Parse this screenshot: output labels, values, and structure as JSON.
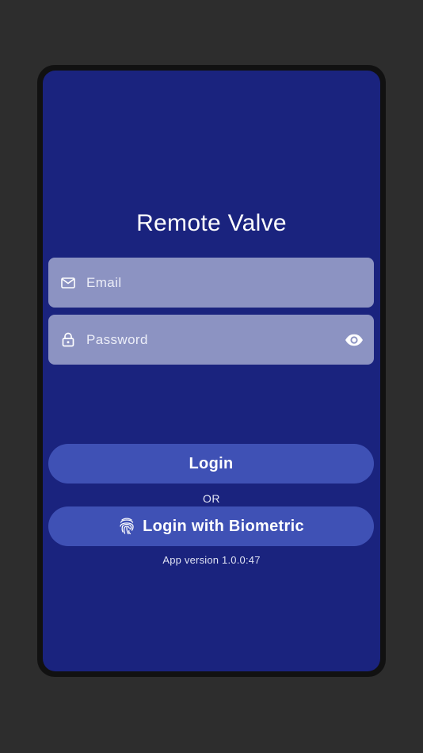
{
  "app": {
    "title": "Remote Valve"
  },
  "form": {
    "email": {
      "placeholder": "Email",
      "value": "",
      "icon": "mail-icon"
    },
    "password": {
      "placeholder": "Password",
      "value": "",
      "icon": "lock-icon",
      "toggle_icon": "eye-icon"
    }
  },
  "actions": {
    "login_label": "Login",
    "separator": "OR",
    "biometric_label": "Login with Biometric",
    "biometric_icon": "fingerprint-icon"
  },
  "footer": {
    "version": "App version 1.0.0:47"
  },
  "colors": {
    "background": "#1a237e",
    "field": "#8c93c2",
    "button": "#3f51b5",
    "outer": "#2d2d2d"
  }
}
